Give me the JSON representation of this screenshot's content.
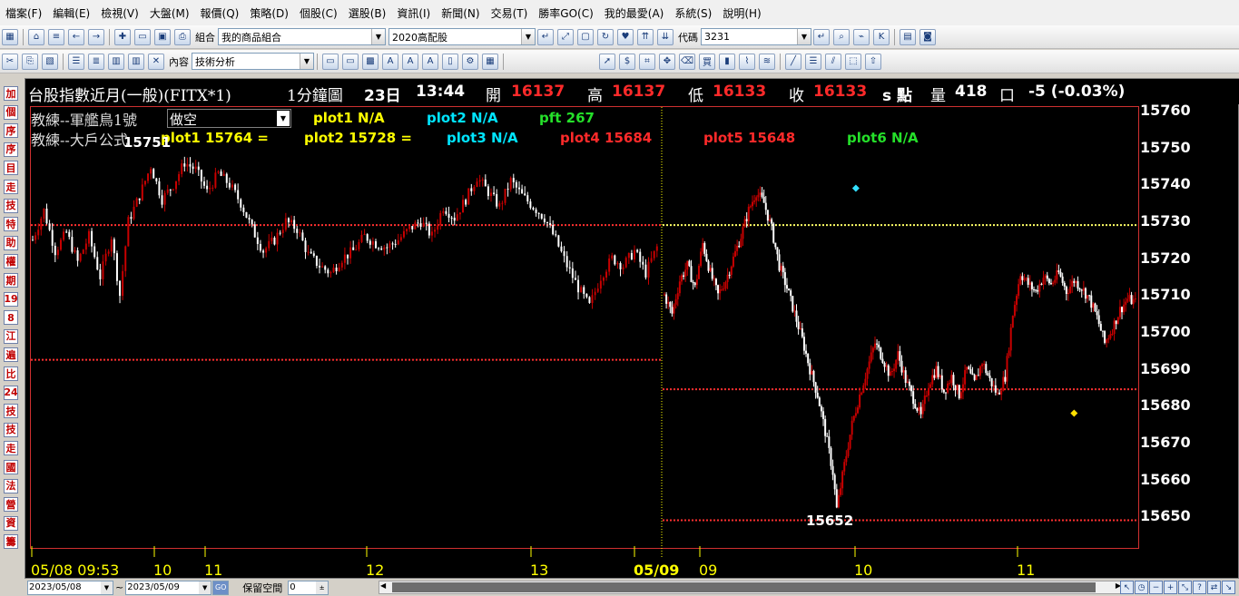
{
  "menu": [
    "檔案(F)",
    "編輯(E)",
    "檢視(V)",
    "大盤(M)",
    "報價(Q)",
    "策略(D)",
    "個股(C)",
    "選股(B)",
    "資訊(I)",
    "新聞(N)",
    "交易(T)",
    "勝率GO(C)",
    "我的最愛(A)",
    "系統(S)",
    "說明(H)"
  ],
  "toolbar1": {
    "group_label": "組合",
    "portfolio": "我的商品組合",
    "group2": "2020高配股",
    "code_label": "代碼",
    "code_value": "3231"
  },
  "toolbar2": {
    "content_label": "內容",
    "analysis_select": "技術分析"
  },
  "left_buttons": [
    "加",
    "個",
    "序",
    "序",
    "目",
    "走",
    "技",
    "特",
    "助",
    "權",
    "期",
    "19",
    "8",
    "江",
    "遍",
    "比",
    "24",
    "技",
    "技",
    "走",
    "國",
    "法",
    "營",
    "資",
    "籌"
  ],
  "quote": {
    "name": "台股指數近月(一般)(FITX*1)",
    "period": "1分鐘圖",
    "day": "23日",
    "time": "13:44",
    "open_label": "開",
    "open": "16137",
    "high_label": "高",
    "high": "16137",
    "low_label": "低",
    "low": "16133",
    "close_label": "收",
    "close": "16133",
    "unit": "s 點",
    "volume_label": "量",
    "volume": "418",
    "volume_unit": "口",
    "change": "-5 (-0.03%)"
  },
  "indicator1": {
    "name": "教練--軍艦鳥1號",
    "select_value": "做空",
    "plot1": "plot1 N/A",
    "plot2": "plot2 N/A",
    "pft": "pft 267"
  },
  "indicator2": {
    "name": "教練--大戶公式",
    "plot1": "plot1 15764 =",
    "plot2": "plot2 15728 =",
    "plot3": "plot3 N/A",
    "plot4": "plot4 15684",
    "plot5": "plot5 15648",
    "plot6": "plot6 N/A"
  },
  "annotations": {
    "high_label": "15751",
    "low_label": "15652"
  },
  "bottom": {
    "start_date": "2023/05/08",
    "tilde": "~",
    "end_date": "2023/05/09",
    "go": "GO",
    "reserve_label": "保留空間",
    "reserve_value": "0"
  },
  "colors": {
    "up": "#c80000",
    "down": "#ffffff",
    "level_line": "#ff3030",
    "yellow_line": "#ffff66",
    "plot_frame": "#d03030",
    "background": "#000000"
  },
  "chart_data": {
    "type": "candlestick",
    "x_tick_labels": [
      "05/08 09:53",
      "10",
      "11",
      "12",
      "13",
      "05/09",
      "09",
      "10",
      "11"
    ],
    "y_tick_labels": [
      "15760",
      "15750",
      "15740",
      "15730",
      "15720",
      "15710",
      "15700",
      "15690",
      "15680",
      "15670",
      "15660",
      "15650"
    ],
    "ylim": [
      15641,
      15761
    ],
    "grid": false,
    "day1_path": [
      [
        0,
        15725
      ],
      [
        4,
        15733
      ],
      [
        8,
        15722
      ],
      [
        12,
        15727
      ],
      [
        16,
        15719
      ],
      [
        20,
        15726
      ],
      [
        24,
        15715
      ],
      [
        28,
        15726
      ],
      [
        31,
        15710
      ],
      [
        34,
        15730
      ],
      [
        38,
        15737
      ],
      [
        42,
        15745
      ],
      [
        46,
        15736
      ],
      [
        50,
        15740
      ],
      [
        54,
        15746
      ],
      [
        58,
        15744
      ],
      [
        62,
        15738
      ],
      [
        66,
        15743
      ],
      [
        70,
        15740
      ],
      [
        74,
        15735
      ],
      [
        78,
        15728
      ],
      [
        82,
        15722
      ],
      [
        86,
        15725
      ],
      [
        90,
        15730
      ],
      [
        94,
        15728
      ],
      [
        98,
        15721
      ],
      [
        102,
        15718
      ],
      [
        106,
        15716
      ],
      [
        110,
        15720
      ],
      [
        114,
        15722
      ],
      [
        118,
        15726
      ],
      [
        122,
        15724
      ],
      [
        126,
        15723
      ],
      [
        130,
        15725
      ],
      [
        134,
        15728
      ],
      [
        138,
        15730
      ],
      [
        142,
        15726
      ],
      [
        146,
        15734
      ],
      [
        150,
        15731
      ],
      [
        154,
        15736
      ],
      [
        158,
        15742
      ],
      [
        162,
        15738
      ],
      [
        166,
        15734
      ],
      [
        170,
        15741
      ],
      [
        174,
        15737
      ],
      [
        178,
        15734
      ],
      [
        182,
        15731
      ],
      [
        186,
        15725
      ],
      [
        190,
        15718
      ],
      [
        194,
        15712
      ],
      [
        198,
        15707
      ],
      [
        202,
        15715
      ],
      [
        206,
        15720
      ],
      [
        210,
        15718
      ],
      [
        214,
        15722
      ],
      [
        218,
        15716
      ],
      [
        222,
        15723
      ]
    ],
    "day2_path": [
      [
        0,
        15710
      ],
      [
        4,
        15705
      ],
      [
        8,
        15714
      ],
      [
        12,
        15718
      ],
      [
        16,
        15712
      ],
      [
        20,
        15724
      ],
      [
        24,
        15716
      ],
      [
        28,
        15710
      ],
      [
        32,
        15714
      ],
      [
        36,
        15720
      ],
      [
        40,
        15726
      ],
      [
        44,
        15733
      ],
      [
        48,
        15738
      ],
      [
        52,
        15735
      ],
      [
        56,
        15728
      ],
      [
        60,
        15718
      ],
      [
        64,
        15712
      ],
      [
        68,
        15705
      ],
      [
        72,
        15698
      ],
      [
        76,
        15690
      ],
      [
        80,
        15683
      ],
      [
        84,
        15673
      ],
      [
        88,
        15662
      ],
      [
        90,
        15652
      ],
      [
        94,
        15664
      ],
      [
        98,
        15675
      ],
      [
        102,
        15683
      ],
      [
        106,
        15690
      ],
      [
        110,
        15697
      ],
      [
        114,
        15693
      ],
      [
        118,
        15688
      ],
      [
        122,
        15694
      ],
      [
        126,
        15687
      ],
      [
        130,
        15682
      ],
      [
        134,
        15677
      ],
      [
        138,
        15686
      ],
      [
        142,
        15690
      ],
      [
        146,
        15684
      ],
      [
        150,
        15688
      ],
      [
        154,
        15683
      ],
      [
        158,
        15690
      ],
      [
        162,
        15686
      ],
      [
        166,
        15692
      ],
      [
        170,
        15687
      ],
      [
        174,
        15683
      ],
      [
        178,
        15688
      ],
      [
        182,
        15705
      ],
      [
        186,
        15716
      ],
      [
        190,
        15713
      ],
      [
        194,
        15711
      ],
      [
        198,
        15715
      ],
      [
        202,
        15713
      ],
      [
        206,
        15716
      ],
      [
        210,
        15711
      ],
      [
        214,
        15714
      ],
      [
        218,
        15712
      ],
      [
        222,
        15709
      ],
      [
        226,
        15704
      ],
      [
        230,
        15697
      ],
      [
        234,
        15701
      ],
      [
        238,
        15706
      ],
      [
        242,
        15709
      ],
      [
        246,
        15708
      ]
    ],
    "levels": [
      {
        "value": 15729,
        "segment": "day1",
        "color": "red"
      },
      {
        "value": 15692.5,
        "segment": "day1",
        "color": "red"
      },
      {
        "value": 15729,
        "segment": "day2",
        "color": "yellow"
      },
      {
        "value": 15684.5,
        "segment": "day2",
        "color": "red"
      },
      {
        "value": 15649,
        "segment": "day2",
        "color": "red"
      }
    ],
    "markers": [
      {
        "minute": 100,
        "value": 15739,
        "color": "cyan",
        "segment": "day2"
      },
      {
        "minute": 214,
        "value": 15678,
        "color": "yellow",
        "segment": "day2"
      }
    ]
  }
}
